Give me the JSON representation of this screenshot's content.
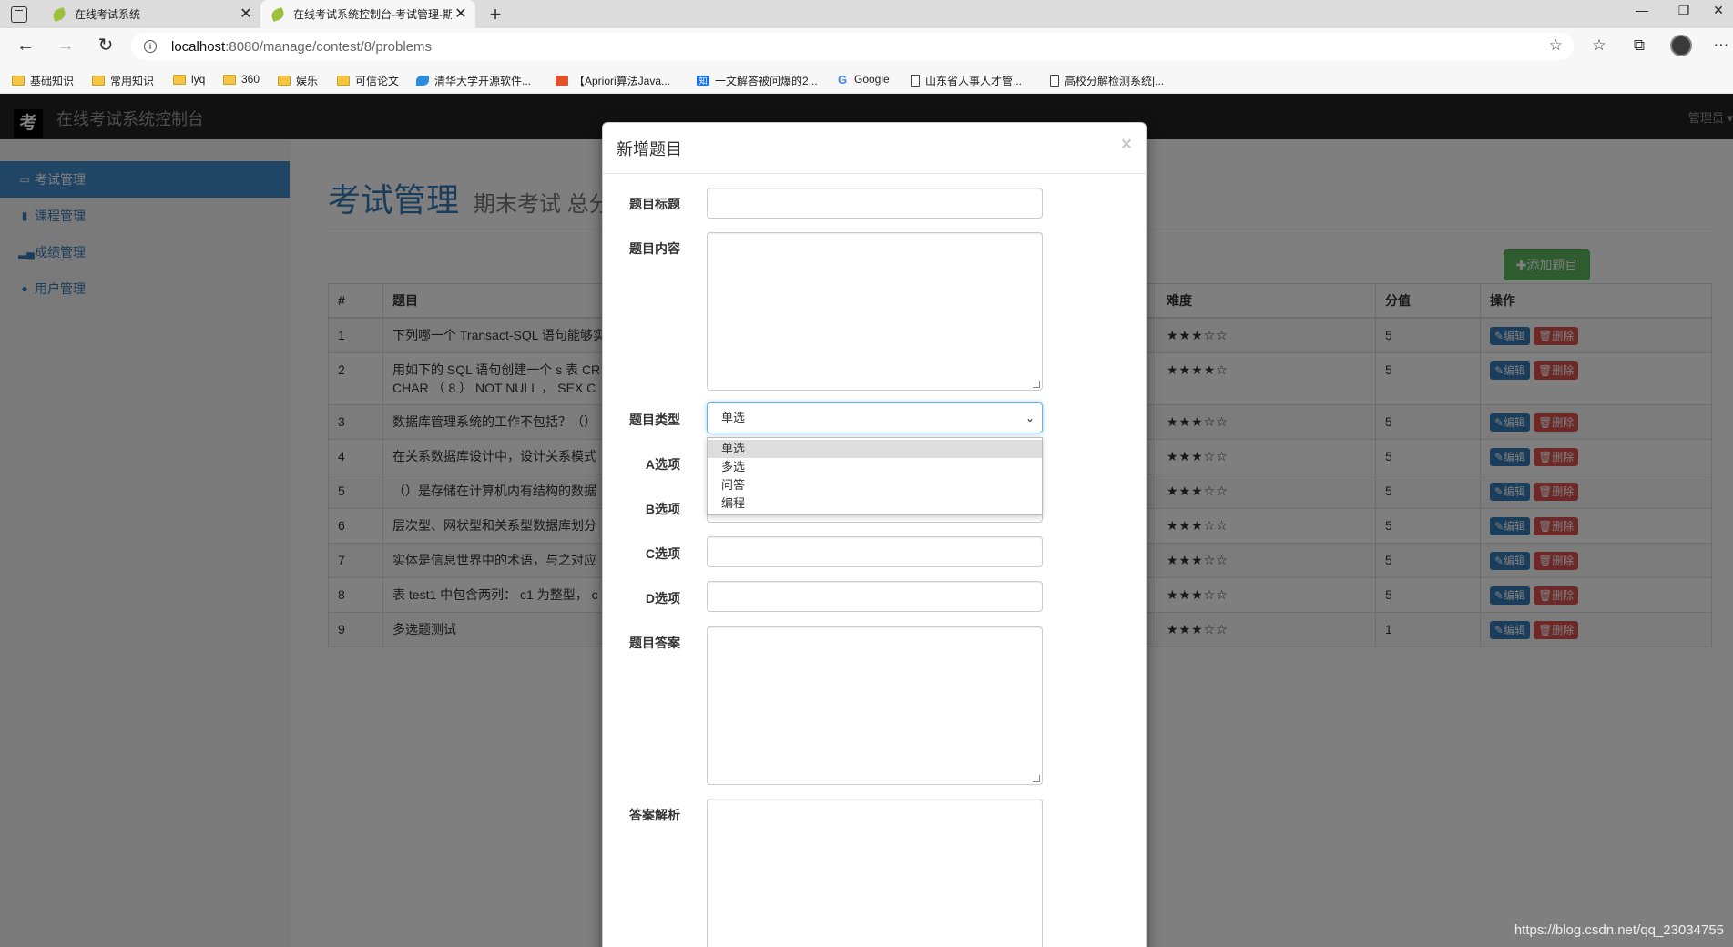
{
  "browser": {
    "tabs": [
      {
        "title": "在线考试系统",
        "active": false
      },
      {
        "title": "在线考试系统控制台-考试管理-期末考试",
        "active": true
      }
    ],
    "url_host": "localhost",
    "url_rest": ":8080/manage/contest/8/problems",
    "bookmarks": [
      {
        "label": "基础知识",
        "icon": "folder-icon"
      },
      {
        "label": "常用知识",
        "icon": "folder-icon"
      },
      {
        "label": "lyq",
        "icon": "folder-icon"
      },
      {
        "label": "360",
        "icon": "folder-icon"
      },
      {
        "label": "娱乐",
        "icon": "folder-icon"
      },
      {
        "label": "可信论文",
        "icon": "folder-icon"
      },
      {
        "label": "清华大学开源软件...",
        "icon": "tuna-icon"
      },
      {
        "label": "【Apriori算法Java...",
        "icon": "jianshu-icon"
      },
      {
        "label": "一文解答被问爆的2...",
        "icon": "zhihu-icon"
      },
      {
        "label": "Google",
        "icon": "google-icon"
      },
      {
        "label": "山东省人事人才管...",
        "icon": "page-icon"
      },
      {
        "label": "高校分解检测系统|...",
        "icon": "page-icon"
      }
    ]
  },
  "app": {
    "logo": "考",
    "title": "在线考试系统控制台",
    "admin": "管理员 ▾"
  },
  "sidebar": {
    "items": [
      {
        "label": "考试管理",
        "icon": "monitor-icon",
        "active": true
      },
      {
        "label": "课程管理",
        "icon": "book-icon",
        "active": false
      },
      {
        "label": "成绩管理",
        "icon": "bar-chart-icon",
        "active": false
      },
      {
        "label": "用户管理",
        "icon": "user-icon",
        "active": false
      }
    ]
  },
  "main": {
    "title": "考试管理",
    "subtitle": "期末考试  总分",
    "add_button": "✚添加题目",
    "table": {
      "headers": [
        "#",
        "题目",
        "难度",
        "分值",
        "操作"
      ],
      "rows": [
        {
          "id": "1",
          "title": "下列哪一个 Transact-SQL 语句能够实",
          "difficulty": "★★★☆☆",
          "score": "5"
        },
        {
          "id": "2",
          "title": "用如下的 SQL 语句创建一个 s 表 CR\nCHAR （ 8 ） NOT NULL ， SEX C",
          "difficulty": "★★★★☆",
          "score": "5"
        },
        {
          "id": "3",
          "title": "数据库管理系统的工作不包括？（）",
          "difficulty": "★★★☆☆",
          "score": "5"
        },
        {
          "id": "4",
          "title": "在关系数据库设计中，设计关系模式",
          "difficulty": "★★★☆☆",
          "score": "5"
        },
        {
          "id": "5",
          "title": "（）是存储在计算机内有结构的数据",
          "difficulty": "★★★☆☆",
          "score": "5"
        },
        {
          "id": "6",
          "title": "层次型、网状型和关系型数据库划分",
          "difficulty": "★★★☆☆",
          "score": "5"
        },
        {
          "id": "7",
          "title": "实体是信息世界中的术语，与之对应",
          "difficulty": "★★★☆☆",
          "score": "5"
        },
        {
          "id": "8",
          "title": "表 test1 中包含两列： c1 为整型， c",
          "difficulty": "★★★☆☆",
          "score": "5"
        },
        {
          "id": "9",
          "title": "多选题测试",
          "difficulty": "★★★☆☆",
          "score": "1"
        }
      ],
      "edit_label": "✎编辑",
      "delete_label": "🗑删除"
    }
  },
  "modal": {
    "title": "新增题目",
    "close": "×",
    "fields": {
      "title_label": "题目标题",
      "content_label": "题目内容",
      "type_label": "题目类型",
      "a_label": "A选项",
      "b_label": "B选项",
      "c_label": "C选项",
      "d_label": "D选项",
      "answer_label": "题目答案",
      "analysis_label": "答案解析"
    },
    "type_select": {
      "value": "单选",
      "options": [
        "单选",
        "多选",
        "问答",
        "编程"
      ]
    }
  },
  "watermark": "https://blog.csdn.net/qq_23034755"
}
